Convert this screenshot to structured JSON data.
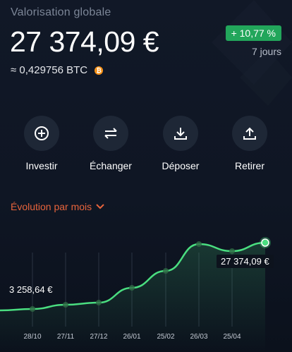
{
  "header": {
    "label": "Valorisation globale",
    "total": "27 374,09 €",
    "btc_equivalent": "≈ 0,429756 BTC",
    "btc_icon": "bitcoin-icon",
    "performance": "+ 10,77 %",
    "period": "7 jours"
  },
  "actions": [
    {
      "label": "Investir",
      "icon": "plus-circle-icon"
    },
    {
      "label": "Échanger",
      "icon": "swap-arrows-icon"
    },
    {
      "label": "Déposer",
      "icon": "download-icon"
    },
    {
      "label": "Retirer",
      "icon": "upload-icon"
    }
  ],
  "chart_section": {
    "title": "Évolution par mois",
    "start_value_label": "3 258,64 €",
    "end_value_label": "27 374,09 €"
  },
  "colors": {
    "accent_green": "#4ade80",
    "badge_green": "#22a65b",
    "orange": "#e8643c"
  },
  "chart_data": {
    "type": "line",
    "x": [
      "28/10",
      "27/11",
      "27/12",
      "26/01",
      "25/02",
      "26/03",
      "25/04"
    ],
    "values": [
      3258.64,
      3500,
      3600,
      8000,
      13000,
      27000,
      27374.09
    ],
    "grid": "vertical",
    "title": "Évolution par mois"
  }
}
